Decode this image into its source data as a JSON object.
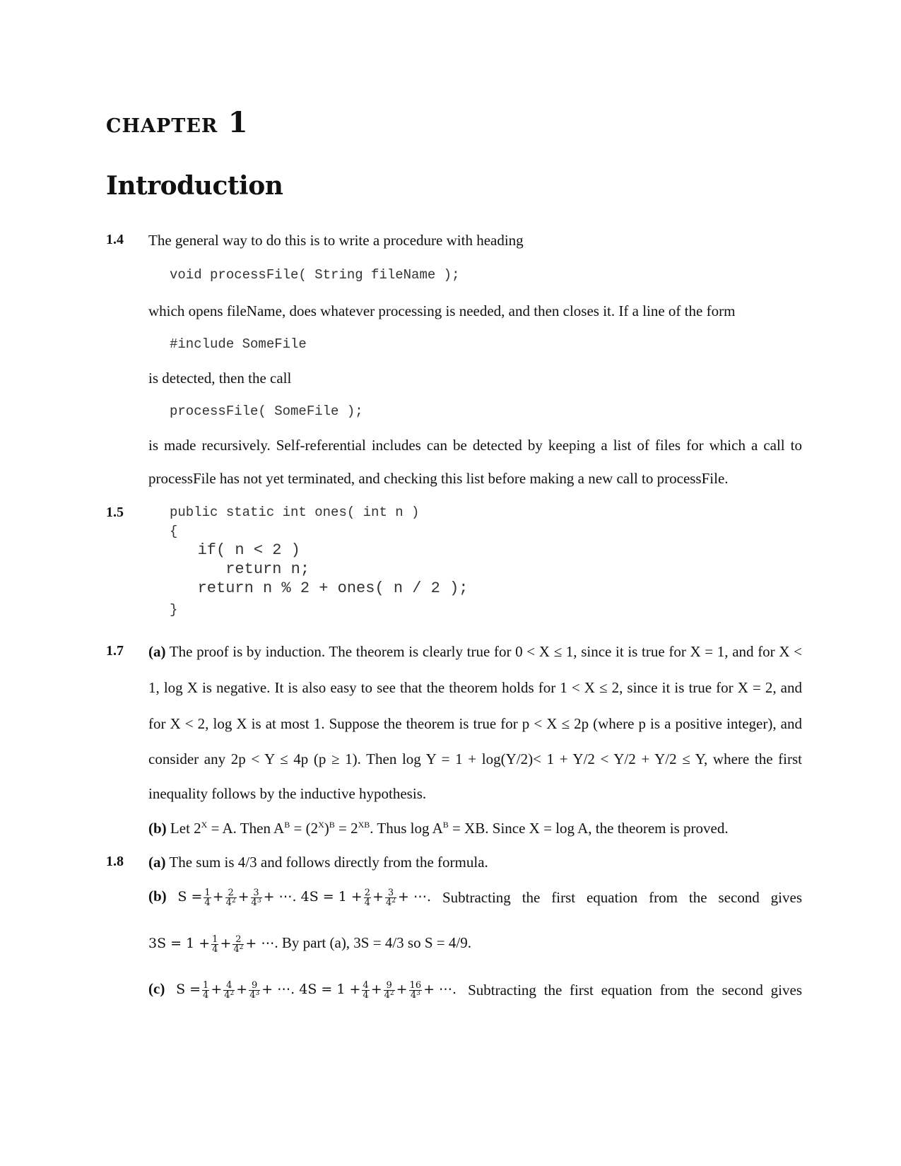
{
  "chapter": {
    "label": "CHAPTER",
    "number": "1",
    "title": "Introduction"
  },
  "sections": {
    "s1_4": {
      "number": "1.4",
      "intro": "The general way to do this is to write a procedure with heading",
      "code1": "void processFile( String fileName );",
      "text2": "which opens fileName, does whatever processing is needed, and then closes it. If a line of the form",
      "code2": "#include SomeFile",
      "text3": "is detected, then the call",
      "code3": "processFile( SomeFile );",
      "text4a": "is made recursively. Self-referential includes can be detected by keeping a list of files for which a call to",
      "text4b": "processFile has not yet terminated, and checking this list before making a new call to processFile."
    },
    "s1_5": {
      "number": "1.5",
      "code_lines": [
        "public static int ones( int n )",
        "{",
        "   if( n < 2 )",
        "      return n;",
        "   return n % 2 + ones( n / 2 );",
        "}"
      ]
    },
    "s1_7": {
      "number": "1.7",
      "a_label": "(a)",
      "a_lines": [
        "The proof is by induction. The theorem is clearly true for 0 < X ≤ 1, since it is true for X = 1, and for X <",
        "1, log X is negative. It is also easy to see that the theorem holds for 1 < X ≤ 2, since it is true for X = 2, and",
        "for X < 2, log X is at most 1. Suppose the theorem is true for p < X ≤ 2p (where p is a positive integer), and",
        "consider any 2p < Y ≤ 4p (p ≥ 1). Then log Y = 1 + log(Y/2)< 1 + Y/2 < Y/2 + Y/2 ≤ Y, where the first",
        "inequality follows by the inductive hypothesis."
      ],
      "b_label": "(b)",
      "b_parts": {
        "p1": "Let 2",
        "sup1": "X",
        "p2": " = A. Then A",
        "sup2": "B",
        "p3": " = (2",
        "sup3": "X",
        "p4": ")",
        "sup4": "B",
        "p5": " = 2",
        "sup5": "XB",
        "p6": ". Thus log A",
        "sup6": "B",
        "p7": " = XB. Since X = log A, the theorem is proved."
      }
    },
    "s1_8": {
      "number": "1.8",
      "a_label": "(a)",
      "a_text": "The sum is 4/3 and follows directly from the formula.",
      "b_label": "(b)",
      "b_tail": "Subtracting the first equation from the second gives",
      "b_line2_tail": ". By part (a), 3S = 4/3 so S = 4/9.",
      "c_label": "(c)",
      "c_tail": "Subtracting the first equation from the second gives"
    }
  }
}
